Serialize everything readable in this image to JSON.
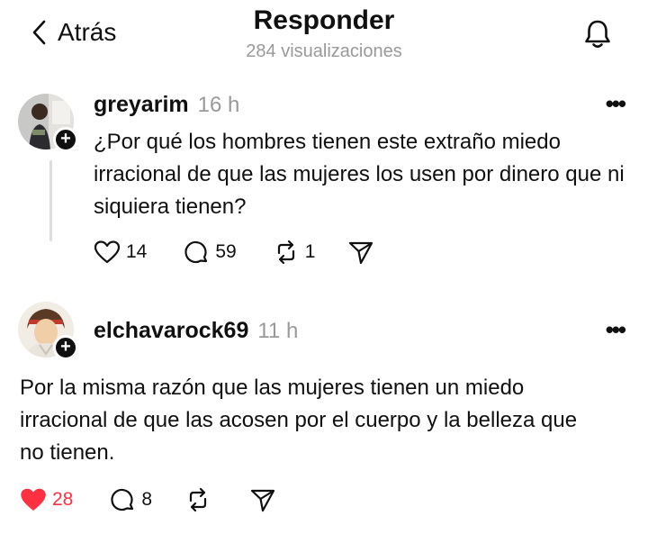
{
  "header": {
    "back_label": "Atrás",
    "title": "Responder",
    "views": "284 visualizaciones",
    "icons": {
      "back": "chevron-left-icon",
      "notifications": "bell-icon"
    }
  },
  "posts": [
    {
      "username": "greyarim",
      "time": "16 h",
      "text": "¿Por qué los hombres tienen este extraño miedo irracional de que las mujeres los usen por dinero que ni siquiera tienen?",
      "likes": "14",
      "comments": "59",
      "reposts": "1",
      "liked": false
    },
    {
      "username": "elchavarock69",
      "time": "11 h",
      "text": "Por la misma razón que las mujeres tienen un miedo irracional de que las acosen por el cuerpo y la belleza que no tienen.",
      "likes": "28",
      "comments": "8",
      "reposts": "",
      "liked": true
    }
  ],
  "icons": {
    "more": "more-icon",
    "like": "heart-icon",
    "comment": "comment-icon",
    "repost": "repost-icon",
    "share": "share-icon"
  },
  "colors": {
    "text": "#101010",
    "muted": "#999999",
    "like": "#ff3040"
  }
}
